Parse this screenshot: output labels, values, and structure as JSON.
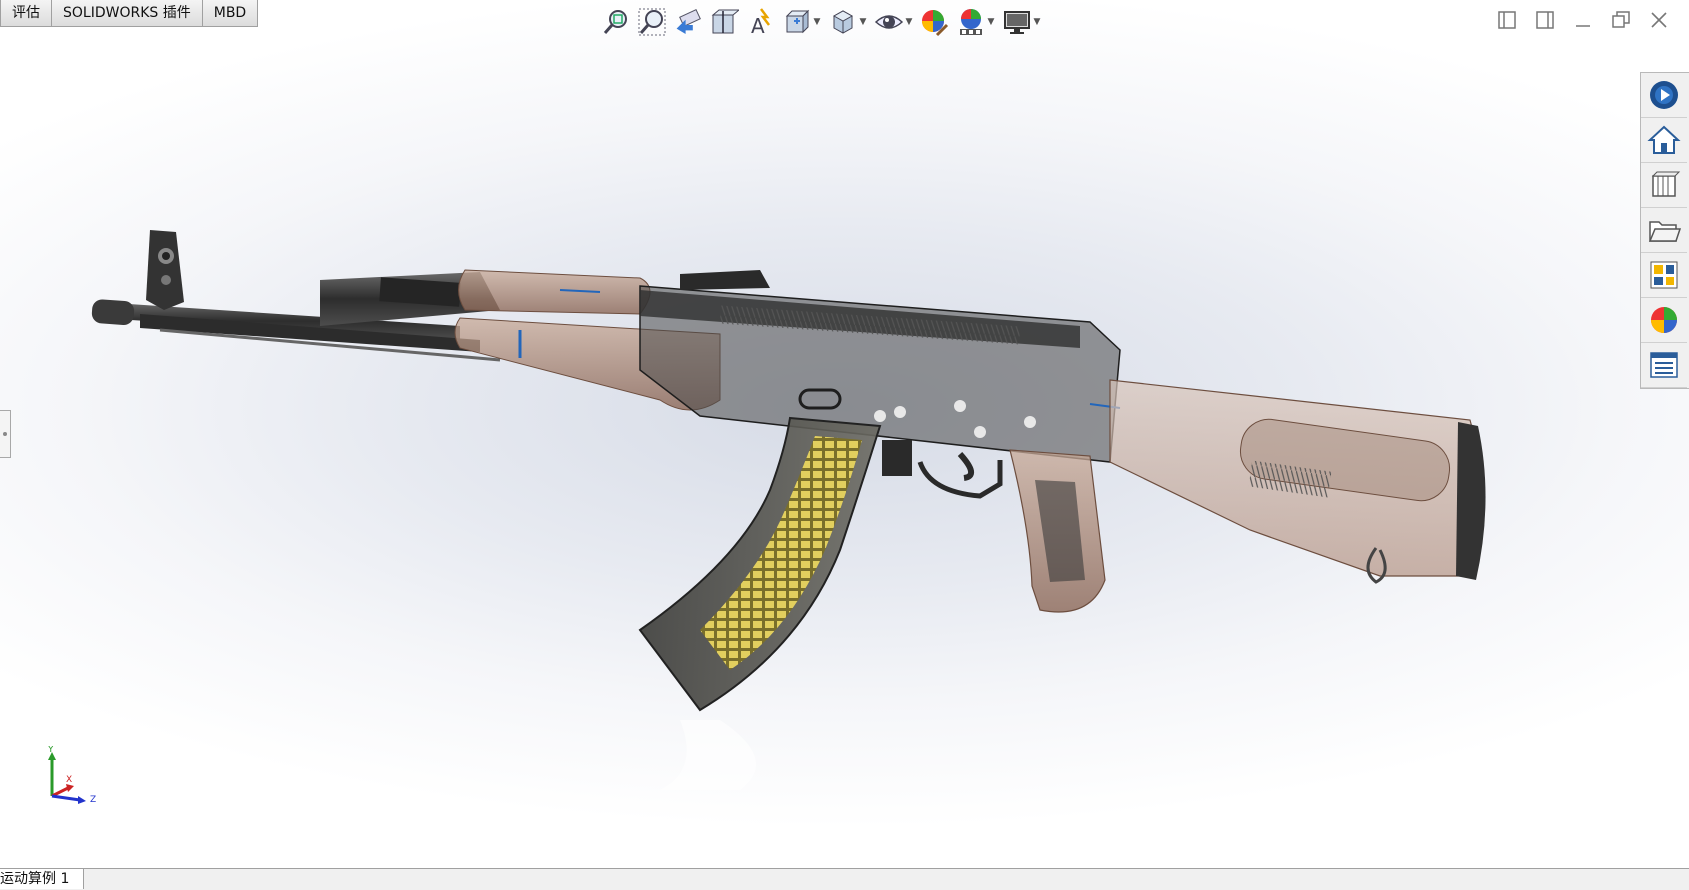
{
  "command_tabs": [
    "评估",
    "SOLIDWORKS 插件",
    "MBD"
  ],
  "view_toolbar": [
    {
      "icon": "zoom-to-fit-icon",
      "dropdown": false
    },
    {
      "icon": "zoom-to-area-icon",
      "dropdown": false
    },
    {
      "icon": "previous-view-icon",
      "dropdown": false
    },
    {
      "icon": "section-view-icon",
      "dropdown": false
    },
    {
      "icon": "dynamic-annotation-views-icon",
      "dropdown": false
    },
    {
      "icon": "view-orientation-icon",
      "dropdown": true
    },
    {
      "icon": "display-style-icon",
      "dropdown": true
    },
    {
      "icon": "hide-show-items-icon",
      "dropdown": true
    },
    {
      "icon": "edit-appearance-icon",
      "dropdown": false
    },
    {
      "icon": "apply-scene-icon",
      "dropdown": true
    },
    {
      "icon": "view-setting-icon",
      "dropdown": true
    }
  ],
  "task_pane": [
    "solidworks-resources-icon",
    "home-icon",
    "design-library-icon",
    "file-explorer-icon",
    "view-palette-icon",
    "appearances-scenes-icon",
    "custom-properties-icon"
  ],
  "triad": {
    "y_label": "Y",
    "x_label": "X",
    "z_label": "Z"
  },
  "bottom_bar": {
    "motion_study_tab": "运动算例 1"
  },
  "colors": {
    "receiver": "#3c3c3c",
    "furniture_wood": "#a88570",
    "magazine_cartridge": "#d7c45a",
    "accent_blue": "#2266bb"
  }
}
